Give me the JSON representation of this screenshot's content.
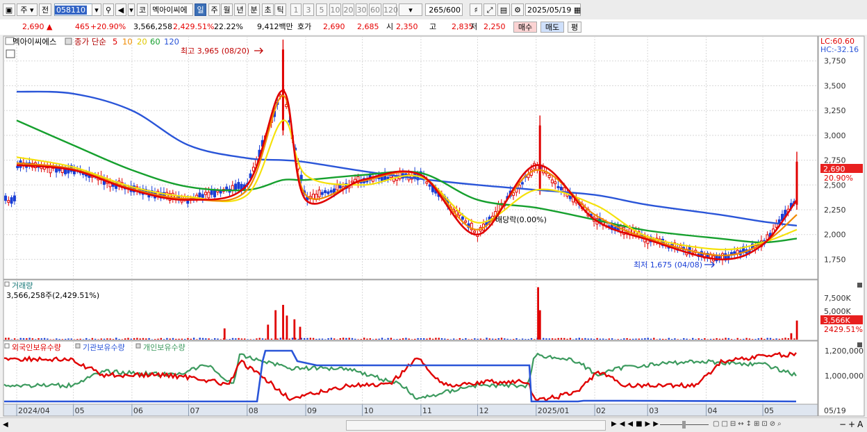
{
  "toolbar": {
    "market": "주",
    "type": "전",
    "code": "058110",
    "ko_label": "코",
    "stock_name": "멕아이씨에",
    "periods": [
      "일",
      "주",
      "월",
      "년",
      "분",
      "초",
      "틱"
    ],
    "selected_period": "일",
    "intervals": [
      "1",
      "3",
      "5",
      "10",
      "20",
      "30",
      "60",
      "120"
    ],
    "count": "265",
    "count_total": "/600",
    "date": "2025/05/19"
  },
  "info": {
    "price": "2,690",
    "arrow": "▲",
    "change": "465",
    "change_pct": "+20.90%",
    "volume": "3,566,258",
    "volume_pct": "2,429.51%",
    "turnover": "22.22%",
    "amount": "9,412백만",
    "ask_label": "호가",
    "ask1": "2,690",
    "ask2": "2,685",
    "open_label": "시",
    "open": "2,350",
    "high_label": "고",
    "high": "2,835",
    "low_label": "저",
    "low": "2,250",
    "buy": "매수",
    "sell": "매도",
    "eval": "평"
  },
  "chart_title": {
    "name": "멕아이씨에스",
    "ma_prefix": "종가 단순",
    "ma5": "5",
    "ma10": "10",
    "ma20": "20",
    "ma60": "60",
    "ma120": "120"
  },
  "colors": {
    "candle_up": "#e00000",
    "candle_down": "#1a3fd6",
    "ma5": "#e00000",
    "ma10": "#f08a00",
    "ma20": "#f5e10a",
    "ma60": "#16a02e",
    "ma120": "#2a55d8",
    "foreign": "#e00000",
    "institution": "#2a55d8",
    "individual": "#3c9a5e",
    "tag_red": "#e8201f"
  },
  "annotations": {
    "high": "최고 3,965 (08/20)",
    "low": "최저 1,675 (04/08)",
    "dividend": "배당락(0.00%)",
    "lc": "LC:60.60",
    "hc": "HC:-32.16"
  },
  "price_tag": {
    "value": "2,690",
    "pct": "20.90%"
  },
  "volume_panel": {
    "title": "거래량",
    "value": "3,566,258주(2,429.51%)",
    "tag": "3,566K",
    "tag_pct": "2429.51%",
    "ticks": [
      "7,500K",
      "5,000K"
    ]
  },
  "holding_panel": {
    "foreign": "외국인보유수량",
    "institution": "기관보유수량",
    "individual": "개인보유수량",
    "ticks": [
      "1,200,000",
      "1,000,000"
    ]
  },
  "x_labels": [
    "2024/04",
    "05",
    "06",
    "07",
    "08",
    "09",
    "10",
    "11",
    "12",
    "2025/01",
    "02",
    "03",
    "04",
    "05",
    "05/19"
  ],
  "chart_data": {
    "type": "line",
    "title": "멕아이씨에스",
    "xlabel": "",
    "ylabel": "",
    "y_ticks": [
      3750,
      3500,
      3250,
      3000,
      2750,
      2500,
      2250,
      2000,
      1750
    ],
    "ylim": [
      1550,
      4000
    ],
    "x": [
      "2024-04",
      "2024-05",
      "2024-06",
      "2024-07",
      "2024-08",
      "2024-08-20",
      "2024-09",
      "2024-10",
      "2024-11",
      "2024-12",
      "2025-01",
      "2025-02",
      "2025-03",
      "2025-04-08",
      "2025-05",
      "2025-05-19"
    ],
    "series": [
      {
        "name": "5",
        "values": [
          2700,
          2650,
          2450,
          2350,
          2500,
          3450,
          2350,
          2550,
          2600,
          2000,
          2700,
          2150,
          1950,
          1750,
          1900,
          2350
        ]
      },
      {
        "name": "10",
        "values": [
          2720,
          2660,
          2460,
          2360,
          2450,
          3400,
          2400,
          2540,
          2600,
          2050,
          2650,
          2200,
          1960,
          1790,
          1910,
          2200
        ]
      },
      {
        "name": "20",
        "values": [
          2780,
          2680,
          2480,
          2380,
          2400,
          3150,
          2600,
          2500,
          2580,
          2120,
          2450,
          2300,
          1980,
          1850,
          1920,
          2050
        ]
      },
      {
        "name": "60",
        "values": [
          3150,
          2900,
          2650,
          2480,
          2450,
          2550,
          2550,
          2600,
          2620,
          2350,
          2270,
          2150,
          2040,
          1960,
          1920,
          1960
        ]
      },
      {
        "name": "120",
        "values": [
          3440,
          3420,
          3250,
          2900,
          2770,
          2750,
          2730,
          2640,
          2560,
          2500,
          2450,
          2400,
          2300,
          2200,
          2130,
          2090
        ]
      }
    ],
    "volume": {
      "ylim": [
        0,
        10000000
      ],
      "spikes": [
        {
          "x": "2024-07-20",
          "value": 2100000
        },
        {
          "x": "2024-08-12",
          "value": 2800000
        },
        {
          "x": "2024-08-16",
          "value": 5500000
        },
        {
          "x": "2024-08-20",
          "value": 6500000
        },
        {
          "x": "2024-08-22",
          "value": 4500000
        },
        {
          "x": "2024-08-26",
          "value": 3800000
        },
        {
          "x": "2024-08-29",
          "value": 2400000
        },
        {
          "x": "2025-01-02",
          "value": 9800000
        },
        {
          "x": "2025-01-03",
          "value": 5500000
        },
        {
          "x": "2025-05-16",
          "value": 1200000
        },
        {
          "x": "2025-05-19",
          "value": 3566258
        }
      ]
    }
  }
}
